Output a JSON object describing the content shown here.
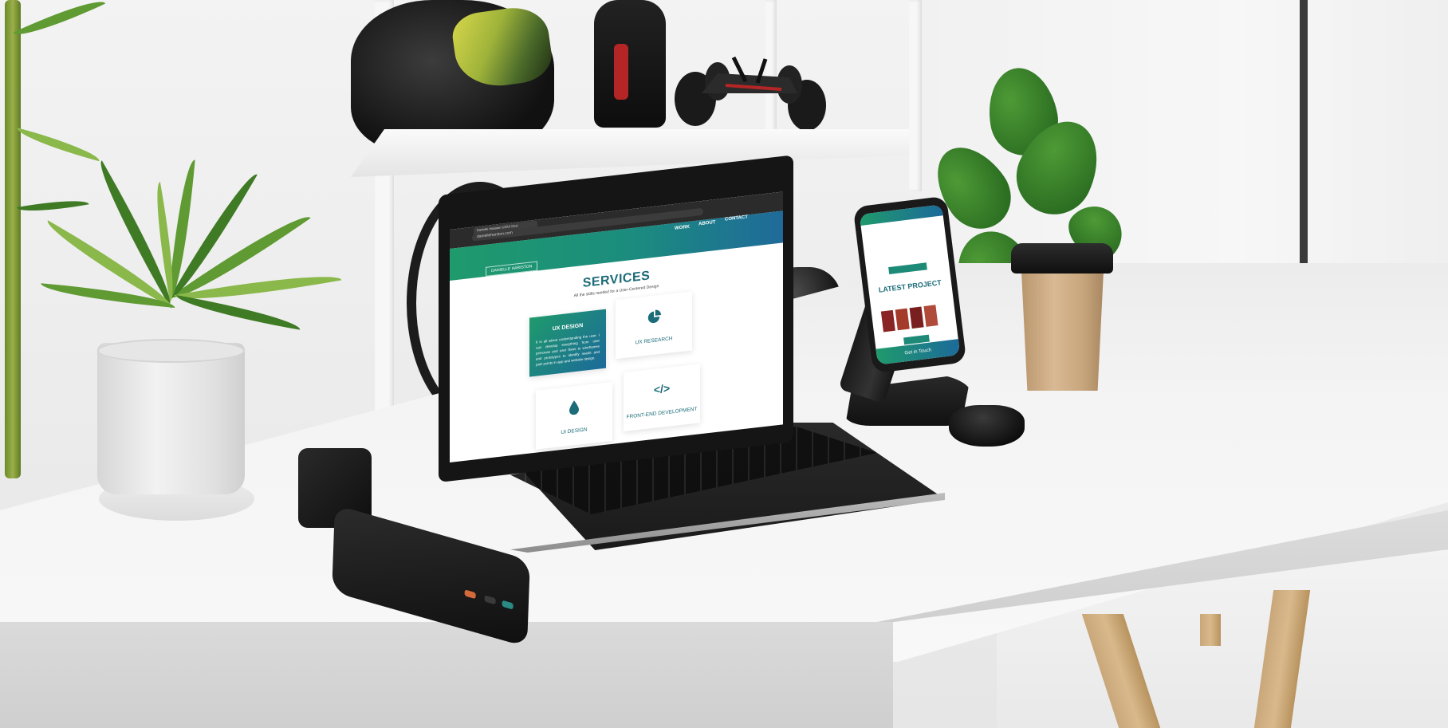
{
  "laptop_screen": {
    "tab_title": "Danielle Hariston UX/UI Desi",
    "url": "danielleharston.com",
    "site_brand": "DANIELLE HARISTON",
    "nav": [
      "WORK",
      "ABOUT",
      "CONTACT"
    ],
    "heading": "SERVICES",
    "subheading": "All the skills needed for a User-Centered Design",
    "services": [
      {
        "title": "UX DESIGN",
        "text": "It is all about understanding the user. I can develop everything from user personas and user flows to wireframes and prototypes to identify needs and pain points in app and website design.",
        "icon": "none"
      },
      {
        "title": "UX RESEARCH",
        "icon": "pie-chart-icon"
      },
      {
        "title": "UI DESIGN",
        "icon": "drop-icon"
      },
      {
        "title": "FRONT-END DEVELOPMENT",
        "icon": "code-icon"
      }
    ]
  },
  "phone_screen": {
    "heading": "LATEST PROJECT",
    "footer": "Get in Touch"
  },
  "colors": {
    "brand_green": "#1f9a6c",
    "brand_blue": "#1c6a9a",
    "heading_teal": "#1c6b78"
  }
}
